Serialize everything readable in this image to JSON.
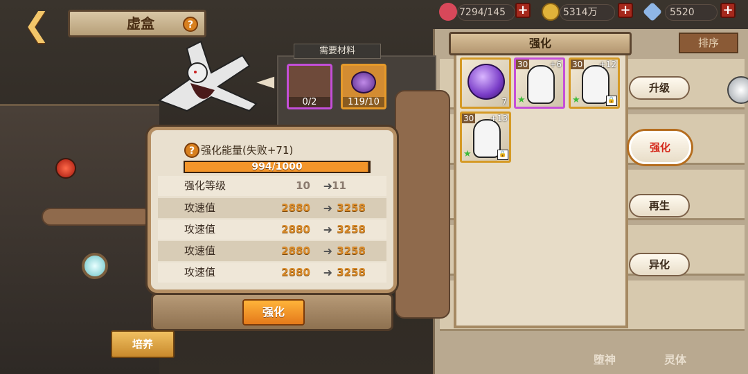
{
  "topbar": {
    "title": "虚盒",
    "resources": [
      {
        "name": "stamina",
        "value": "7294/145",
        "icon": "heart-icon",
        "color": "#d8485a"
      },
      {
        "name": "gold",
        "value": "5314万",
        "icon": "coin-icon",
        "color": "#e0b23a"
      },
      {
        "name": "crystal",
        "value": "5520",
        "icon": "crystal-icon",
        "color": "#8fb6e6"
      }
    ]
  },
  "materials": {
    "header": "需要材料",
    "slots": [
      {
        "count": "0/2",
        "icon": "empty-material-icon"
      },
      {
        "count": "119/10",
        "icon": "purple-orb-icon"
      }
    ]
  },
  "upgrade_panel": {
    "energy_label": "强化能量(失败+71)",
    "energy_text": "994/1000",
    "energy_progress": 0.994,
    "rows": [
      {
        "label": "强化等级",
        "from": "10",
        "to": "11"
      },
      {
        "label": "攻速值",
        "from": "2880",
        "to": "3258"
      },
      {
        "label": "攻速值",
        "from": "2880",
        "to": "3258"
      },
      {
        "label": "攻速值",
        "from": "2880",
        "to": "3258"
      },
      {
        "label": "攻速值",
        "from": "2880",
        "to": "3258"
      }
    ],
    "button": "强化"
  },
  "popup": {
    "title": "强化",
    "cards": [
      {
        "type": "slime",
        "level": "",
        "plus": "",
        "count": "7",
        "border": "#d59a25"
      },
      {
        "type": "mask",
        "level": "30",
        "plus": "+6",
        "count": "",
        "border": "#c64fd8"
      },
      {
        "type": "mask",
        "level": "30",
        "plus": "+12",
        "count": "",
        "border": "#d59a25"
      },
      {
        "type": "mask",
        "level": "30",
        "plus": "+13",
        "count": "",
        "border": "#d59a25"
      }
    ]
  },
  "side_menu": [
    {
      "label": "升级",
      "active": false
    },
    {
      "label": "强化",
      "active": true
    },
    {
      "label": "再生",
      "active": false
    },
    {
      "label": "异化",
      "active": false
    }
  ],
  "sort_button": "排序",
  "background_numbers": [
    "2880",
    "2880",
    "2880"
  ],
  "bottom": {
    "cultivate": "培养",
    "tabs": [
      "堕神",
      "灵体"
    ]
  }
}
